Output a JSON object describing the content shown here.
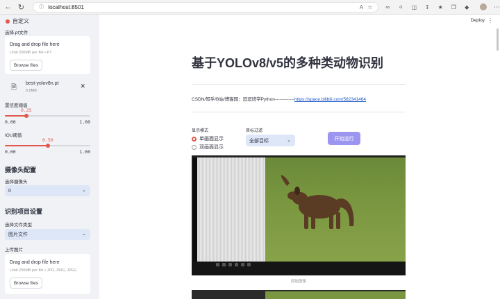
{
  "browser": {
    "url": "localhost:8501"
  },
  "sidebar": {
    "title": "自定义",
    "weights_label": "选择.pt文件",
    "uploader1": {
      "drag_text": "Drag and drop file here",
      "limit_text": "Limit 200MB per file • PT",
      "browse_label": "Browse files"
    },
    "file": {
      "name": "best-yolov8n.pt",
      "size": "6.0MB"
    },
    "conf_slider": {
      "label": "置信度阈值",
      "value": 0.25,
      "value_text": "0.25",
      "min": "0.00",
      "max": "1.00"
    },
    "iou_slider": {
      "label": "IOU阈值",
      "value": 0.5,
      "value_text": "0.50",
      "min": "0.00",
      "max": "1.00"
    },
    "camera_section": {
      "heading": "摄像头配置",
      "select_label": "选择摄像头",
      "select_value": "0"
    },
    "project_section": {
      "heading": "识别项目设置",
      "type_label": "选择文件类型",
      "type_value": "图片文件",
      "upload_label": "上传图片"
    },
    "uploader2": {
      "drag_text": "Drag and drop file here",
      "limit_text": "Limit 200MB per file • JPG, PNG, JPEG",
      "browse_label": "Browse files"
    }
  },
  "header": {
    "deploy_label": "Deploy"
  },
  "main": {
    "title": "基于YOLOv8/v5的多种类动物识别",
    "credits_text": "CSDN/知乎/B站/博客园：逗逗班学Python-------------",
    "credits_link": "https://space.bilibili.com/582341464",
    "display_mode_label": "显示模式",
    "radio_single": "单画面显示",
    "radio_double": "双画面显示",
    "filter_label": "目标过滤",
    "filter_value": "全部目标",
    "run_button": "开始运行",
    "image_caption": "原始图像"
  },
  "colors": {
    "accent": "#e0584e",
    "button": "#9d96f0",
    "select_bg": "#dde7f7",
    "sidebar_bg": "#f0f2f6",
    "link": "#1a55c6"
  }
}
